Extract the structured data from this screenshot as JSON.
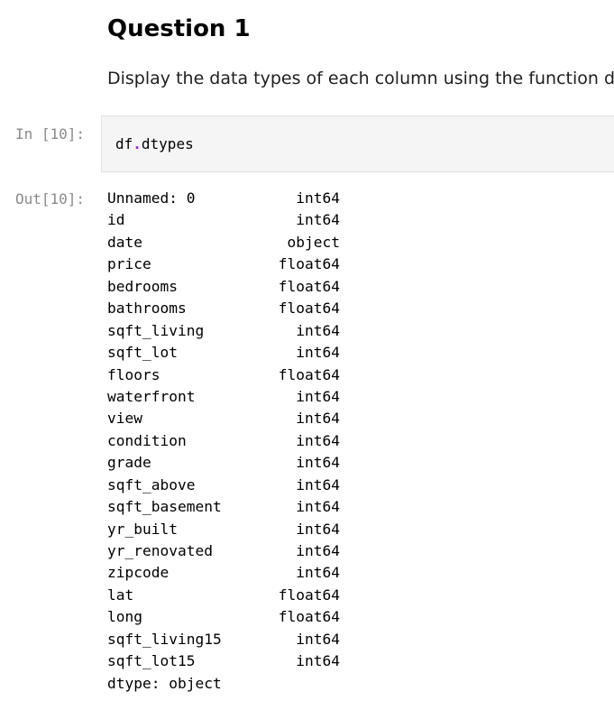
{
  "markdown": {
    "heading": "Question 1",
    "paragraph": "Display the data types of each column using the function dtypes"
  },
  "input_cell": {
    "prompt": "In [10]:",
    "code_object": "df",
    "code_dot": ".",
    "code_attr": "dtypes"
  },
  "output_cell": {
    "prompt": "Out[10]:",
    "rows": [
      {
        "name": "Unnamed: 0",
        "dtype": "int64"
      },
      {
        "name": "id",
        "dtype": "int64"
      },
      {
        "name": "date",
        "dtype": "object"
      },
      {
        "name": "price",
        "dtype": "float64"
      },
      {
        "name": "bedrooms",
        "dtype": "float64"
      },
      {
        "name": "bathrooms",
        "dtype": "float64"
      },
      {
        "name": "sqft_living",
        "dtype": "int64"
      },
      {
        "name": "sqft_lot",
        "dtype": "int64"
      },
      {
        "name": "floors",
        "dtype": "float64"
      },
      {
        "name": "waterfront",
        "dtype": "int64"
      },
      {
        "name": "view",
        "dtype": "int64"
      },
      {
        "name": "condition",
        "dtype": "int64"
      },
      {
        "name": "grade",
        "dtype": "int64"
      },
      {
        "name": "sqft_above",
        "dtype": "int64"
      },
      {
        "name": "sqft_basement",
        "dtype": "int64"
      },
      {
        "name": "yr_built",
        "dtype": "int64"
      },
      {
        "name": "yr_renovated",
        "dtype": "int64"
      },
      {
        "name": "zipcode",
        "dtype": "int64"
      },
      {
        "name": "lat",
        "dtype": "float64"
      },
      {
        "name": "long",
        "dtype": "float64"
      },
      {
        "name": "sqft_living15",
        "dtype": "int64"
      },
      {
        "name": "sqft_lot15",
        "dtype": "int64"
      }
    ],
    "footer": "dtype: object"
  },
  "colors": {
    "code_background": "#f5f5f5",
    "code_border": "#e0e0e0",
    "prompt_text": "#8a8a8a",
    "operator": "#aa22ff"
  }
}
